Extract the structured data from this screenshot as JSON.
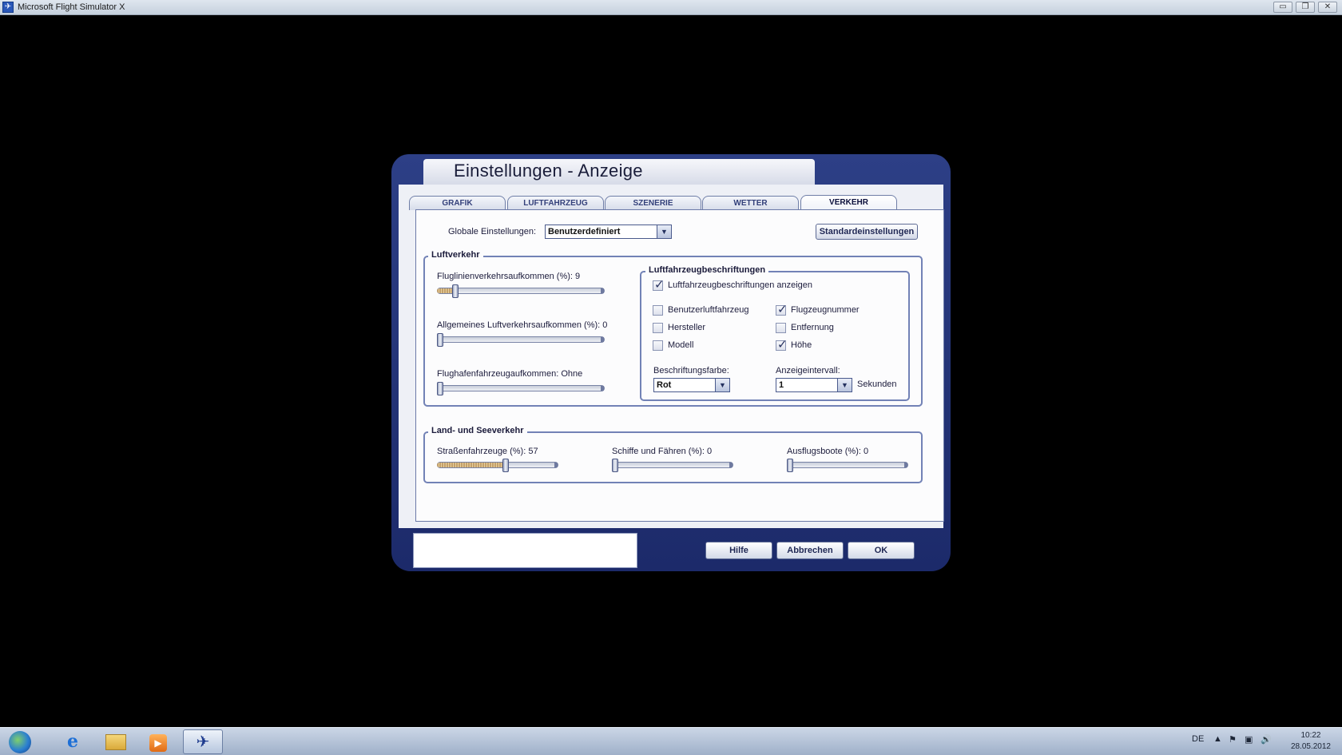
{
  "window": {
    "title": "Microsoft Flight Simulator X",
    "app_icon": "plane-icon",
    "minimize_glyph": "▭",
    "restore_glyph": "❐",
    "close_glyph": "✕"
  },
  "dialog": {
    "title": "Einstellungen - Anzeige",
    "tabs": [
      {
        "label": "GRAFIK",
        "active": false
      },
      {
        "label": "LUFTFAHRZEUG",
        "active": false
      },
      {
        "label": "SZENERIE",
        "active": false
      },
      {
        "label": "WETTER",
        "active": false
      },
      {
        "label": "VERKEHR",
        "active": true
      }
    ],
    "global_label": "Globale Einstellungen:",
    "global_value": "Benutzerdefiniert",
    "defaults_button": "Standardeinstellungen",
    "air_traffic": {
      "title": "Luftverkehr",
      "sliders": [
        {
          "label": "Fluglinienverkehrsaufkommen (%): 9",
          "value": 9
        },
        {
          "label": "Allgemeines Luftverkehrsaufkommen (%): 0",
          "value": 0
        },
        {
          "label": "Flughafenfahrzeugaufkommen: Ohne",
          "value": 0
        }
      ]
    },
    "labels_group": {
      "title": "Luftfahrzeugbeschriftungen",
      "show_labels": {
        "label": "Luftfahrzeugbeschriftungen anzeigen",
        "checked": true
      },
      "options": [
        {
          "label": "Benutzerluftfahrzeug",
          "checked": false
        },
        {
          "label": "Flugzeugnummer",
          "checked": true
        },
        {
          "label": "Hersteller",
          "checked": false
        },
        {
          "label": "Entfernung",
          "checked": false
        },
        {
          "label": "Modell",
          "checked": false
        },
        {
          "label": "Höhe",
          "checked": true
        }
      ],
      "color_label": "Beschriftungsfarbe:",
      "color_value": "Rot",
      "interval_label": "Anzeigeintervall:",
      "interval_value": "1",
      "interval_unit": "Sekunden"
    },
    "land_sea": {
      "title": "Land- und Seeverkehr",
      "sliders": [
        {
          "label": "Straßenfahrzeuge (%): 57",
          "value": 57
        },
        {
          "label": "Schiffe und Fähren (%): 0",
          "value": 0
        },
        {
          "label": "Ausflugsboote (%): 0",
          "value": 0
        }
      ]
    },
    "buttons": {
      "help": "Hilfe",
      "cancel": "Abbrechen",
      "ok": "OK"
    }
  },
  "taskbar": {
    "language": "DE",
    "time": "10:22",
    "date": "28.05.2012"
  }
}
